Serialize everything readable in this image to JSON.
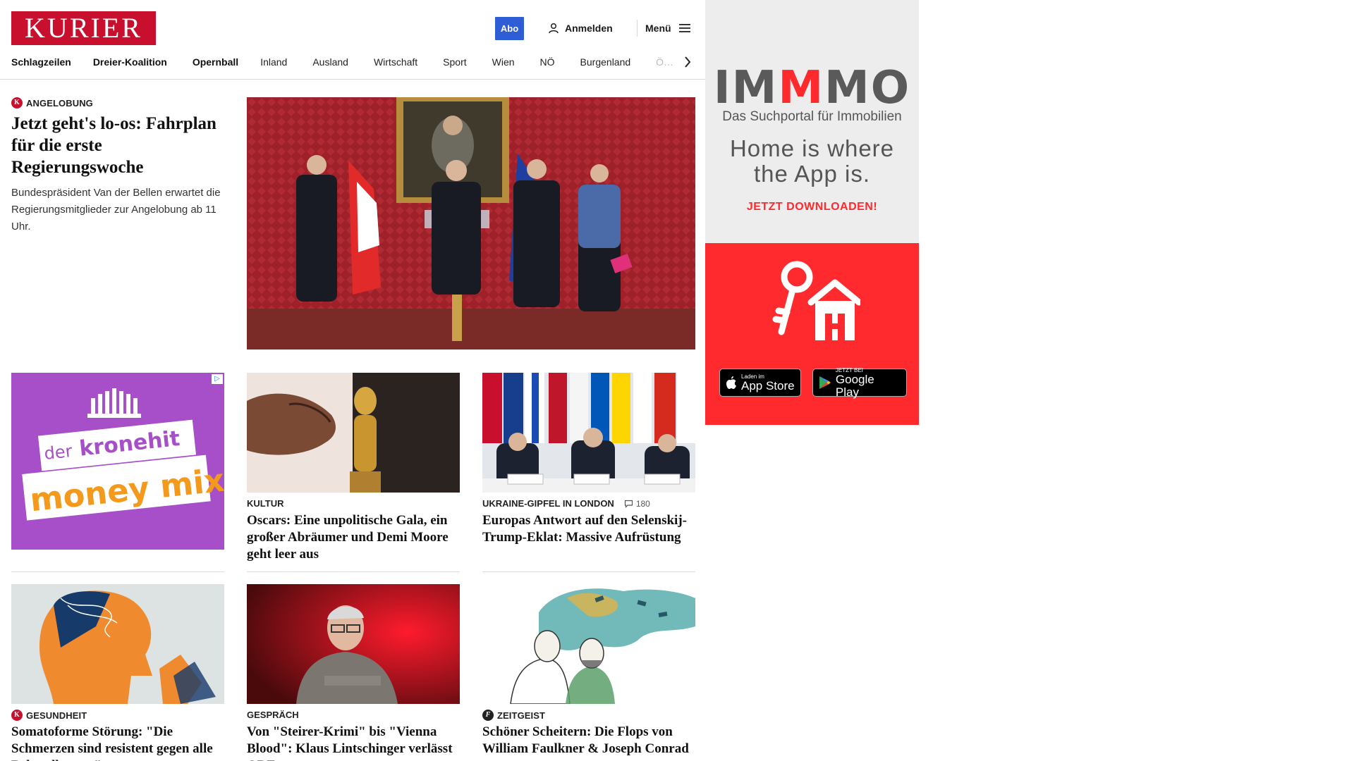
{
  "header": {
    "logo": "KURIER",
    "abo": "Abo",
    "login": "Anmelden",
    "menu": "Menü"
  },
  "nav": {
    "items": [
      "Schlagzeilen",
      "Dreier-Koalition",
      "Opernball",
      "Inland",
      "Ausland",
      "Wirtschaft",
      "Sport",
      "Wien",
      "NÖ",
      "Burgenland"
    ],
    "truncated": "Ö…"
  },
  "lead": {
    "kicker": "ANGELOBUNG",
    "badge": "K",
    "title": "Jetzt geht's lo-os: Fahrplan für die erste Regierungswoche",
    "subtitle": "Bundespräsident Van der Bellen erwartet die Regierungsmitglieder zur Angelobung ab 11 Uhr."
  },
  "ads": {
    "kronehit": {
      "line1": "der",
      "line2": "kronehit",
      "line3": "money mix",
      "adchoice": "▷"
    },
    "immmo": {
      "logo_a": "IM",
      "logo_b": "M",
      "logo_c": "MO",
      "subtitle": "Das Suchportal für Immobilien",
      "claim_1": "Home is where",
      "claim_2": "the App is.",
      "cta": "JETZT DOWNLOADEN!",
      "appstore_small": "Laden im",
      "appstore_big": "App Store",
      "google_small": "JETZT BEI",
      "google_big": "Google Play"
    }
  },
  "cards": [
    {
      "kicker": "KULTUR",
      "title": "Oscars: Eine unpolitische Gala, ein großer Abräumer und Demi Moore geht leer aus"
    },
    {
      "kicker": "UKRAINE-GIPFEL IN LONDON",
      "comments": "180",
      "title": "Europas Antwort auf den Selenskij-Trump-Eklat: Massive Aufrüstung"
    },
    {
      "kicker": "GESUNDHEIT",
      "badge": "K",
      "title": "Somatoforme Störung: \"Die Schmerzen sind resistent gegen alle Behandlungen\""
    },
    {
      "kicker": "GESPRÄCH",
      "title": "Von \"Steirer-Krimi\" bis \"Vienna Blood\": Klaus Lintschinger verlässt ORF"
    },
    {
      "kicker": "ZEITGEIST",
      "badge": "f",
      "title": "Schöner Scheitern: Die Flops von William Faulkner & Joseph Conrad"
    }
  ],
  "colors": {
    "brand_red": "#c8102e",
    "abo_blue": "#2f5dd6",
    "immo_red": "#ff2a2e"
  }
}
